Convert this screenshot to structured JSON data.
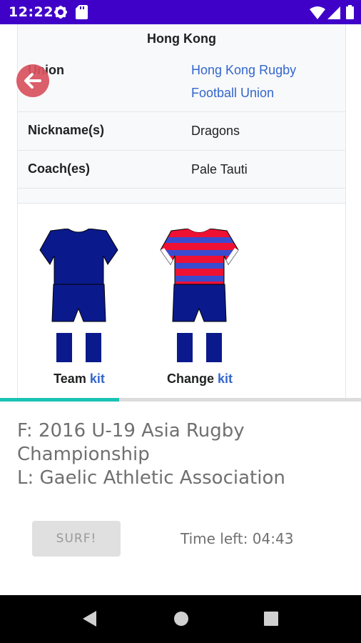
{
  "status_bar": {
    "time": "12:22",
    "icons": [
      "gear-icon",
      "sd-card-icon",
      "wifi-icon",
      "signal-icon",
      "battery-icon"
    ],
    "background": "#3f00c8"
  },
  "infobox": {
    "title": "Hong Kong",
    "rows": [
      {
        "label": "Union",
        "value_line1": "Hong Kong Rugby",
        "value_line2": "Football Union",
        "is_link": true
      },
      {
        "label": "Nickname(s)",
        "value": "Dragons"
      },
      {
        "label": "Coach(es)",
        "value": "Pale Tauti"
      }
    ],
    "kits": [
      {
        "caption_prefix": "Team",
        "caption_link": "kit"
      },
      {
        "caption_prefix": "Change",
        "caption_link": "kit"
      }
    ],
    "link_color": "#3366cc"
  },
  "game": {
    "from_line": "F: 2016 U-19 Asia Rugby Championship",
    "to_line": "L: Gaelic Athletic Association",
    "surf_button": "SURF!",
    "time_left_label": "Time left:",
    "time_left_value": "04:43",
    "progress_fraction": 0.33,
    "progress_color": "#19c3b3"
  },
  "nav_bar": {
    "icons": [
      "back-triangle-icon",
      "home-circle-icon",
      "recents-square-icon"
    ]
  }
}
